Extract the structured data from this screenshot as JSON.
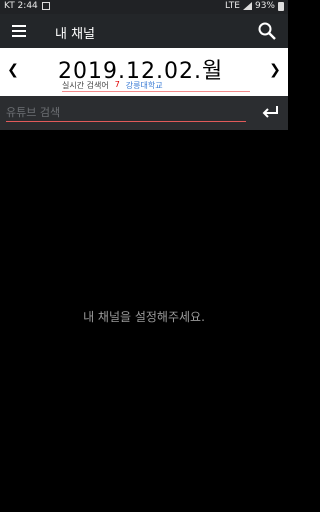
{
  "status_bar": {
    "carrier_time": "KT 2:44",
    "network": "LTE",
    "battery": "93%"
  },
  "app_bar": {
    "title": "내 채널",
    "menu_icon": "hamburger-menu-icon",
    "search_icon": "search-icon"
  },
  "date_nav": {
    "date": "2019.12.02.월",
    "prev_icon": "chevron-left-icon",
    "next_icon": "chevron-right-icon"
  },
  "trending": {
    "label": "실시간 검색어",
    "rank": "7",
    "keyword": "강릉대학교"
  },
  "search": {
    "placeholder": "유튜브 검색",
    "enter_icon": "enter-icon"
  },
  "main": {
    "empty_message": "내 채널을 설정해주세요."
  },
  "colors": {
    "app_bar": "#232629",
    "search_bar": "#2b2d30",
    "rank": "#e00000",
    "keyword": "#3a7bd5",
    "underline": "#e05a5a"
  }
}
